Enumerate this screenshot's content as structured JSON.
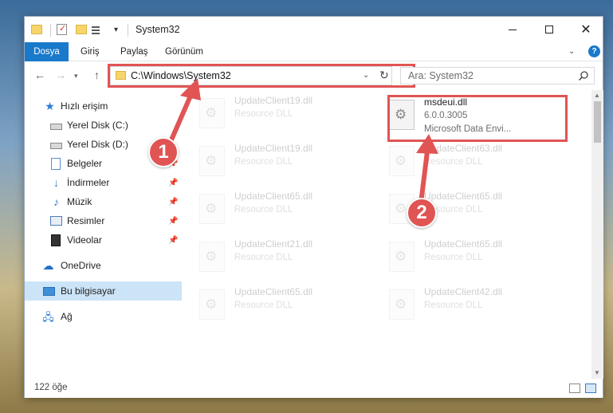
{
  "window": {
    "title": "System32"
  },
  "ribbon": {
    "tabs": [
      {
        "label": "Dosya"
      },
      {
        "label": "Giriş"
      },
      {
        "label": "Paylaş"
      },
      {
        "label": "Görünüm"
      }
    ]
  },
  "address": {
    "path": "C:\\Windows\\System32"
  },
  "search": {
    "placeholder": "Ara: System32"
  },
  "sidebar": {
    "items": [
      {
        "label": "Hızlı erişim",
        "icon": "star-icon"
      },
      {
        "label": "Yerel Disk (C:)",
        "icon": "disk-icon",
        "pinned": true
      },
      {
        "label": "Yerel Disk (D:)",
        "icon": "disk-icon",
        "pinned": true
      },
      {
        "label": "Belgeler",
        "icon": "document-icon",
        "pinned": true
      },
      {
        "label": "İndirmeler",
        "icon": "download-icon",
        "pinned": true
      },
      {
        "label": "Müzik",
        "icon": "music-icon",
        "pinned": true
      },
      {
        "label": "Resimler",
        "icon": "pictures-icon",
        "pinned": true
      },
      {
        "label": "Videolar",
        "icon": "video-icon",
        "pinned": true
      },
      {
        "label": "OneDrive",
        "icon": "cloud-icon"
      },
      {
        "label": "Bu bilgisayar",
        "icon": "computer-icon",
        "selected": true
      },
      {
        "label": "Ağ",
        "icon": "network-icon"
      }
    ]
  },
  "files": [
    {
      "name": "UpdateClient19.dll",
      "desc": "Resource DLL"
    },
    {
      "name": "msdeui.dll",
      "version": "6.0.0.3005",
      "desc": "Microsoft Data Envi...",
      "highlighted": true
    },
    {
      "name": "UpdateClient19.dll",
      "desc": "Resource DLL"
    },
    {
      "name": "UpdateClient63.dll",
      "desc": "Resource DLL"
    },
    {
      "name": "UpdateClient65.dll",
      "desc": "Resource DLL"
    },
    {
      "name": "UpdateClient65.dll",
      "desc": "Resource DLL"
    },
    {
      "name": "UpdateClient21.dll",
      "desc": "Resource DLL"
    },
    {
      "name": "UpdateClient65.dll",
      "desc": "Resource DLL"
    },
    {
      "name": "UpdateClient65.dll",
      "desc": "Resource DLL"
    },
    {
      "name": "UpdateClient42.dll",
      "desc": "Resource DLL"
    }
  ],
  "status": {
    "count": "122 öğe"
  },
  "annotations": [
    {
      "number": "1"
    },
    {
      "number": "2"
    }
  ],
  "colors": {
    "accent": "#1979ca",
    "highlight": "#e05454",
    "selected": "#cce4f7"
  }
}
